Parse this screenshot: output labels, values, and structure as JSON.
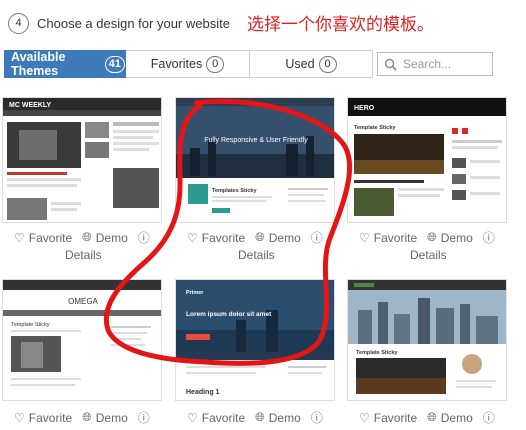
{
  "step": {
    "number": "4",
    "title": "Choose a design for your website"
  },
  "annotation": "选择一个你喜欢的模板。",
  "tabs": [
    {
      "label": "Available Themes",
      "count": "41"
    },
    {
      "label": "Favorites",
      "count": "0"
    },
    {
      "label": "Used",
      "count": "0"
    }
  ],
  "search": {
    "placeholder": "Search..."
  },
  "card_actions": {
    "favorite": "Favorite",
    "demo": "Demo",
    "details": "Details"
  },
  "themes": [
    {
      "header": "MC WEEKLY",
      "caption": "",
      "banner": "",
      "accent": "#c0392b"
    },
    {
      "header": "",
      "caption": "Templates Sticky",
      "banner": "Fully Responsive & User Friendly",
      "accent": "#2a9d8f"
    },
    {
      "header": "HERO",
      "caption": "Template Sticky",
      "banner": "",
      "accent": "#e02525"
    },
    {
      "header": "OMEGA",
      "caption": "Template Sticky",
      "banner": "",
      "accent": "#555555"
    },
    {
      "header": "Primer",
      "caption": "Heading 1",
      "banner": "Lorem ipsum dolor sit amet",
      "accent": "#2c6aa0"
    },
    {
      "header": "",
      "caption": "Template Sticky",
      "banner": "",
      "accent": "#4a8a3c"
    }
  ],
  "colors": {
    "active_tab": "#3d7ab8",
    "annotation_red": "#e02020"
  }
}
